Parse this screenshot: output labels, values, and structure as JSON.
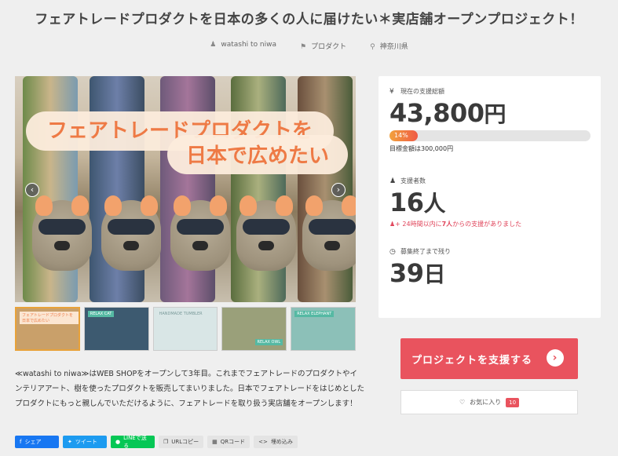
{
  "title": "フェアトレードプロダクトを日本の多くの人に届けたい＊実店舗オープンプロジェクト！",
  "meta": {
    "owner": "watashi to niwa",
    "category": "プロダクト",
    "location": "神奈川県"
  },
  "hero": {
    "banner_line1": "フェアトレードプロダクトを",
    "banner_line2": "日本で広めたい",
    "prev": "‹",
    "next": "›"
  },
  "thumbnails": [
    {
      "label": "フェアトレードプロダクトを日本で広めたい",
      "bg": "#c9a06a"
    },
    {
      "label": "RELAX CAT",
      "bg": "#3d5a70"
    },
    {
      "label": "HANDMADE TUMBLER",
      "bg": "#d9e6e6"
    },
    {
      "label": "RELAX OWL",
      "bg": "#9aa07a"
    },
    {
      "label": "RELAX ELEPHANT",
      "bg": "#8cc0b8"
    }
  ],
  "stats": {
    "funded_label": "現在の支援総額",
    "funded_value": "43,800",
    "funded_unit": "円",
    "progress_percent": 14,
    "progress_text": "14%",
    "goal_text": "目標金額は300,000円",
    "backers_label": "支援者数",
    "backers_value": "16",
    "backers_unit": "人",
    "recent_note_prefix": "24時間以内に",
    "recent_note_count": "7人",
    "recent_note_suffix": "からの支援がありました",
    "remaining_label": "募集終了まで残り",
    "remaining_value": "39",
    "remaining_unit": "日"
  },
  "actions": {
    "support_label": "プロジェクトを支援する",
    "favorite_label": "お気に入り",
    "favorite_count": "10"
  },
  "description": "≪watashi to niwa≫はWEB SHOPをオープンして3年目。これまでフェアトレードのプロダクトやインテリアアート、樹を使ったプロダクトを販売してまいりました。日本でフェアトレードをはじめとしたプロダクトにもっと親しんでいただけるように、フェアトレードを取り扱う実店舗をオープンします！",
  "share": {
    "facebook": "シェア",
    "twitter": "ツイート",
    "line": "LINEで送る",
    "url_copy": "URLコピー",
    "qr": "QRコード",
    "embed": "埋め込み"
  },
  "colors": {
    "accent": "#e9535e",
    "banner_text": "#ee7a45",
    "facebook": "#1877f2",
    "twitter": "#1d9bf0",
    "line": "#06c755"
  }
}
